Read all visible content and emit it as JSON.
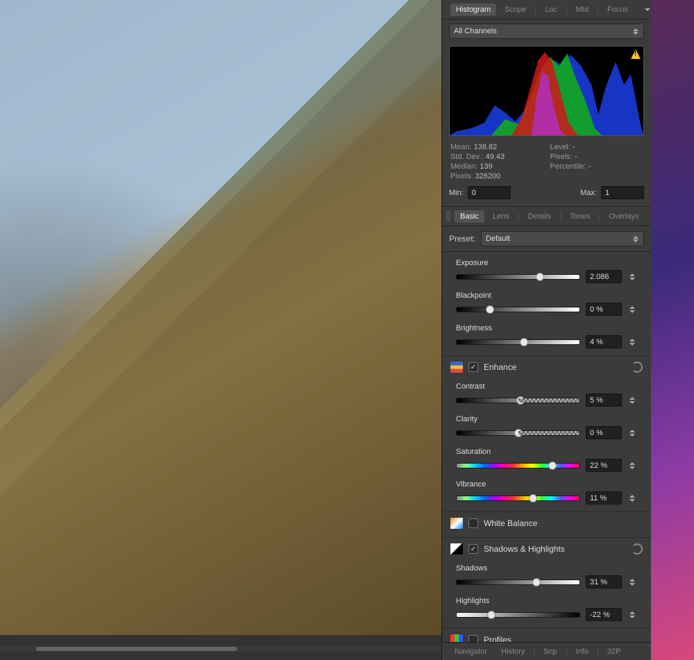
{
  "top_tabs": {
    "histogram": "Histogram",
    "scope": "Scope",
    "loc": "Loc",
    "mtd": "Mtd",
    "focus": "Focus"
  },
  "channels_dropdown": "All Channels",
  "stats": {
    "mean_label": "Mean:",
    "mean": "138.82",
    "stddev_label": "Std. Dev.:",
    "stddev": "49.43",
    "median_label": "Median:",
    "median": "139",
    "pixels_label": "Pixels:",
    "pixels": "326200",
    "level_label": "Level:",
    "level": "-",
    "px_label": "Pixels:",
    "px": "-",
    "pct_label": "Percentile:",
    "pct": "-"
  },
  "minmax": {
    "min_label": "Min:",
    "min": "0",
    "max_label": "Max:",
    "max": "1"
  },
  "mid_tabs": {
    "basic": "Basic",
    "lens": "Lens",
    "details": "Details",
    "tones": "Tones",
    "overlays": "Overlays"
  },
  "preset": {
    "label": "Preset:",
    "value": "Default"
  },
  "sliders": {
    "exposure": {
      "label": "Exposure",
      "value": "2.086",
      "pos": 68
    },
    "blackpoint": {
      "label": "Blackpoint",
      "value": "0 %",
      "pos": 27
    },
    "brightness": {
      "label": "Brightness",
      "value": "4 %",
      "pos": 55
    },
    "contrast": {
      "label": "Contrast",
      "value": "5 %",
      "pos": 52
    },
    "clarity": {
      "label": "Clarity",
      "value": "0 %",
      "pos": 50
    },
    "saturation": {
      "label": "Saturation",
      "value": "22 %",
      "pos": 78
    },
    "vibrance": {
      "label": "Vibrance",
      "value": "11 %",
      "pos": 62
    },
    "shadows": {
      "label": "Shadows",
      "value": "31 %",
      "pos": 65
    },
    "highlights": {
      "label": "Highlights",
      "value": "-22 %",
      "pos": 28
    }
  },
  "subpanels": {
    "enhance": "Enhance",
    "white_balance": "White Balance",
    "shadows_highlights": "Shadows & Highlights",
    "profiles": "Profiles"
  },
  "bottom_tabs": {
    "navigator": "Navigator",
    "history": "History",
    "snp": "Snp",
    "info": "Info",
    "p32": "32P"
  }
}
